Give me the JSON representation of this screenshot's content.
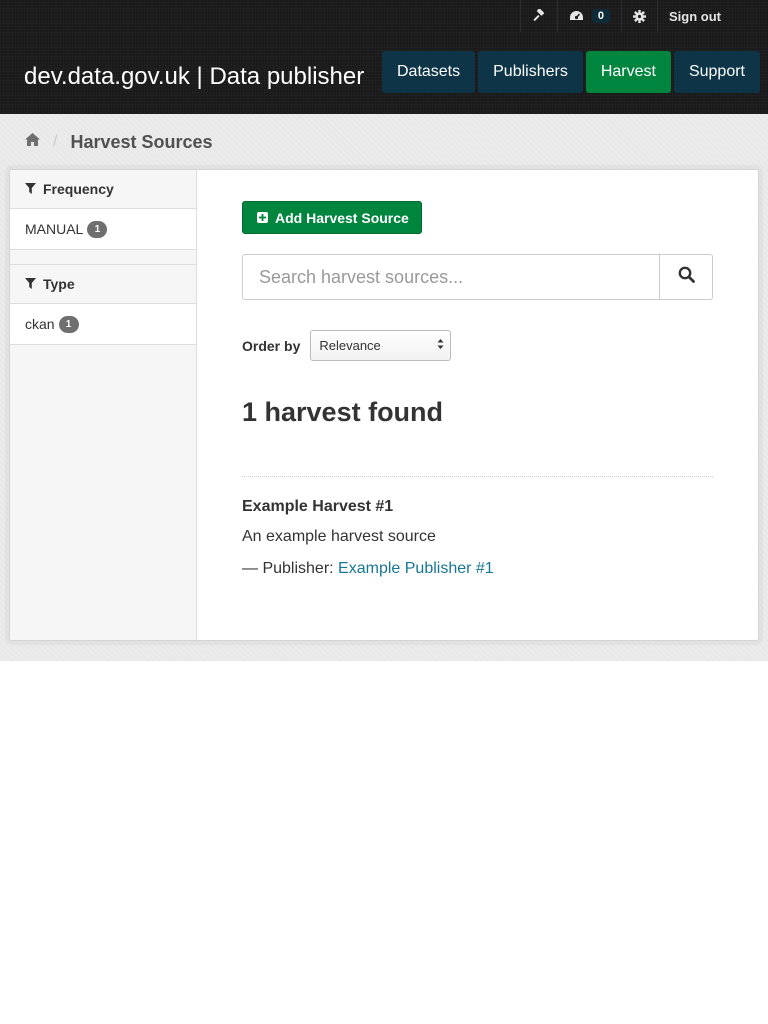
{
  "header": {
    "brand": "dev.data.gov.uk | Data publisher",
    "account": {
      "admin_icon": "gavel-icon",
      "dashboard_icon": "dashboard-icon",
      "dashboard_count": "0",
      "settings_icon": "gear-icon",
      "sign_out_label": "Sign out"
    },
    "nav": [
      {
        "label": "Datasets",
        "active": false
      },
      {
        "label": "Publishers",
        "active": false
      },
      {
        "label": "Harvest",
        "active": true
      },
      {
        "label": "Support",
        "active": false
      }
    ]
  },
  "breadcrumb": {
    "home_icon": "home-icon",
    "separator": "/",
    "current": "Harvest Sources"
  },
  "facets": [
    {
      "title": "Frequency",
      "icon": "filter-icon",
      "items": [
        {
          "label": "MANUAL",
          "count": "1"
        }
      ]
    },
    {
      "title": "Type",
      "icon": "filter-icon",
      "items": [
        {
          "label": "ckan",
          "count": "1"
        }
      ]
    }
  ],
  "main": {
    "add_button_label": "Add Harvest Source",
    "search_placeholder": "Search harvest sources...",
    "order_by_label": "Order by",
    "order_by_value": "Relevance",
    "results_heading": "1 harvest found",
    "results": [
      {
        "title": "Example Harvest #1",
        "description": "An example harvest source",
        "publisher_prefix": "— Publisher: ",
        "publisher_link": "Example Publisher #1"
      }
    ]
  },
  "colors": {
    "header_bg": "#1a1a1a",
    "nav_bg": "#0d3447",
    "nav_active": "#00853f",
    "add_button": "#00853f",
    "link": "#187794"
  }
}
